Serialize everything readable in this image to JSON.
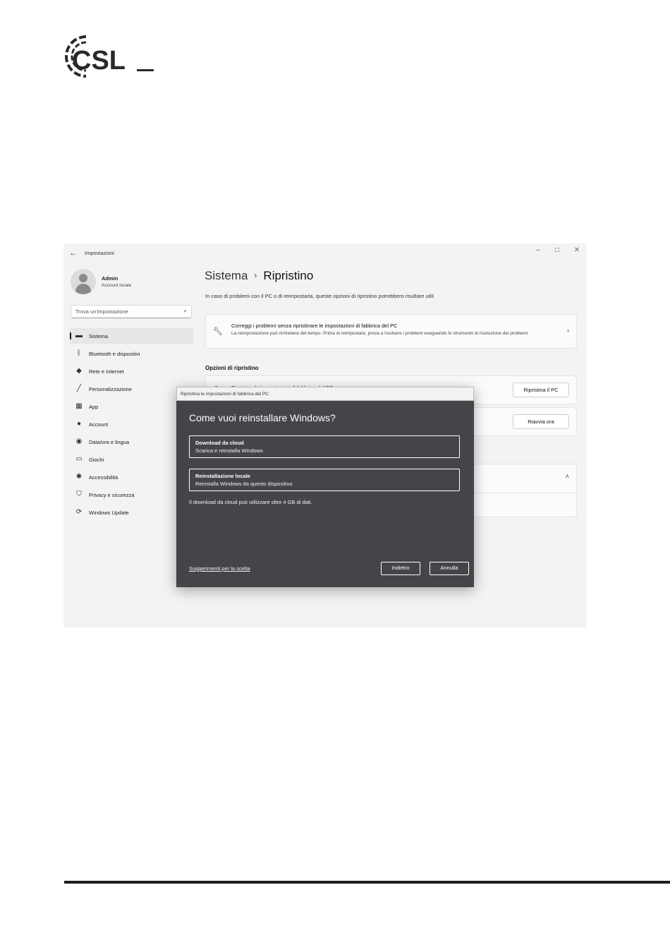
{
  "logo": {
    "text": "CSL",
    "icon": "csl-logo"
  },
  "window": {
    "title": "Impostazioni",
    "controls": {
      "minimize": "–",
      "maximize": "□",
      "close": "✕"
    }
  },
  "profile": {
    "name": "Admin",
    "account_type": "Account locale"
  },
  "search": {
    "placeholder": "Trova un'impostazione"
  },
  "nav": {
    "items": [
      {
        "label": "Sistema",
        "icon": "system-icon",
        "selected": true
      },
      {
        "label": "Bluetooth e dispositivi",
        "icon": "bluetooth-icon"
      },
      {
        "label": "Rete e Internet",
        "icon": "wifi-icon"
      },
      {
        "label": "Personalizzazione",
        "icon": "brush-icon"
      },
      {
        "label": "App",
        "icon": "apps-icon"
      },
      {
        "label": "Account",
        "icon": "person-icon"
      },
      {
        "label": "Data/ora e lingua",
        "icon": "globe-clock-icon"
      },
      {
        "label": "Giochi",
        "icon": "gamepad-icon"
      },
      {
        "label": "Accessibilità",
        "icon": "accessibility-icon"
      },
      {
        "label": "Privacy e sicurezza",
        "icon": "shield-icon"
      },
      {
        "label": "Windows Update",
        "icon": "update-icon"
      }
    ]
  },
  "main": {
    "breadcrumb_parent": "Sistema",
    "breadcrumb_separator": "›",
    "breadcrumb_current": "Ripristino",
    "intro": "In caso di problemi con il PC o di reimpostarla, queste opzioni di ripristino potrebbero risultare utili",
    "troubleshoot_card": {
      "title": "Correggi i problemi senza ripristinare le impostazioni di fabbrica del PC",
      "description": "La reimpostazione può richiedere del tempo. Prima di reimpostare, prova a risolvere i problemi eseguendo lo strumento di risoluzione dei problemi"
    },
    "section_heading": "Opzioni di ripristino",
    "reset_row": {
      "title": "Ripristina le impostazioni di fabbrica del PC",
      "button": "Ripristina il PC"
    },
    "restart_row": {
      "button": "Riavvia ora"
    }
  },
  "dialog": {
    "title": "Ripristina le impostazioni di fabbrica del PC",
    "heading": "Come vuoi reinstallare Windows?",
    "options": [
      {
        "title": "Download da cloud",
        "description": "Scarica e reinstalla Windows"
      },
      {
        "title": "Reinstallazione locale",
        "description": "Reinstalla Windows da questo dispositivo"
      }
    ],
    "note": "Il download da cloud può utilizzare oltre 4 GB di dati.",
    "help_link": "Suggerimenti per la scelta",
    "back_button": "Indietro",
    "cancel_button": "Annulla"
  },
  "colors": {
    "dialog_bg": "#434549",
    "window_bg": "#f3f3f3",
    "rule": "#1e1e1e"
  }
}
